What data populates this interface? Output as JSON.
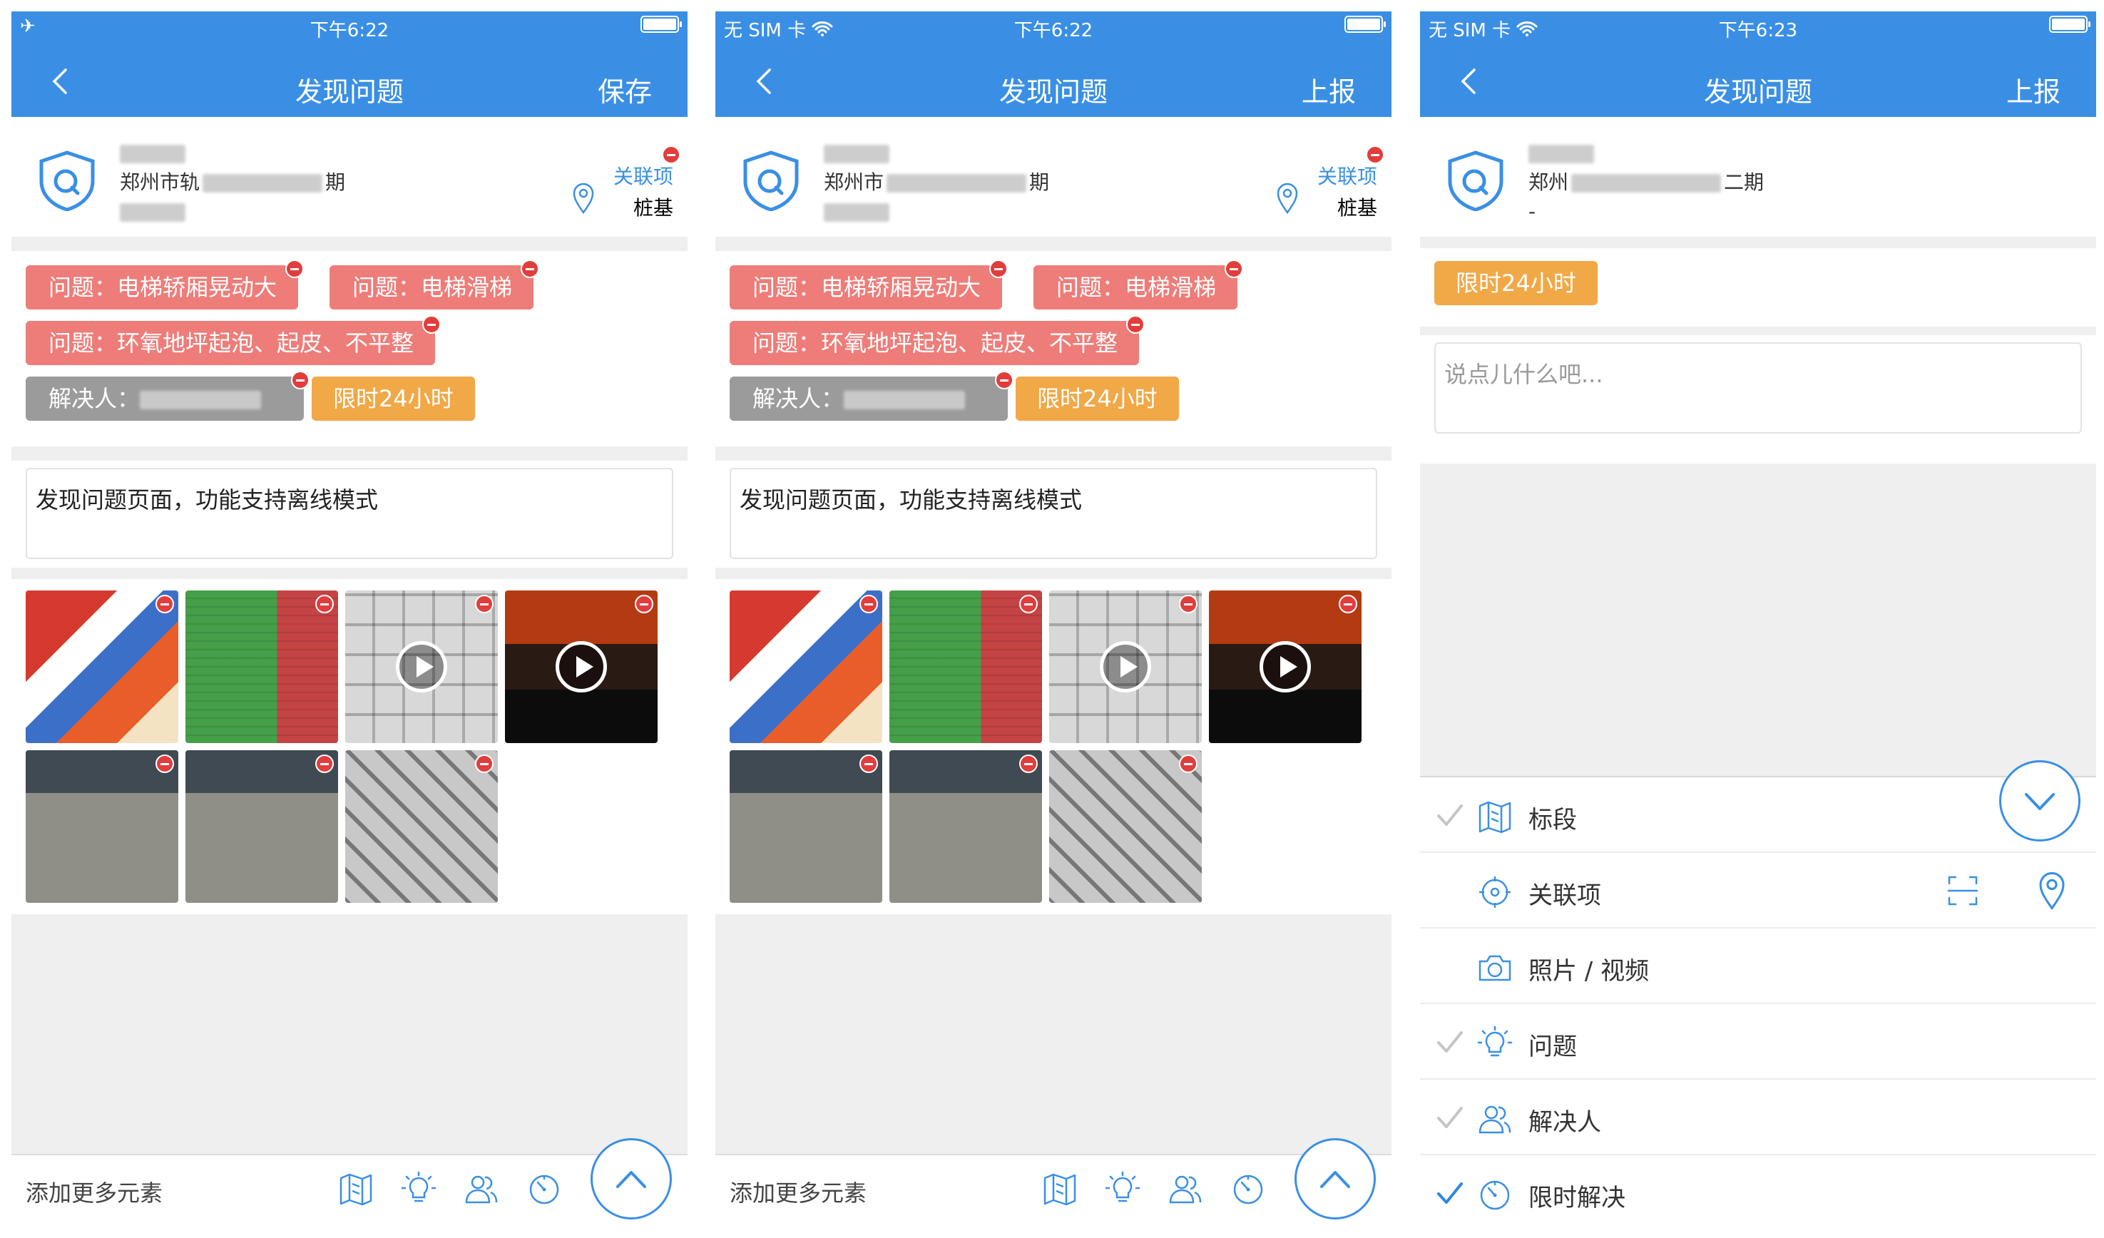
{
  "colors": {
    "primary": "#3a8fe5",
    "tag_red": "#ee7d79",
    "tag_grey": "#9b9b9b",
    "tag_orange": "#f1a846",
    "remove": "#e23d3d"
  },
  "screens": [
    {
      "status": {
        "carrier": "✈",
        "time": "下午6:22"
      },
      "nav": {
        "title": "发现问题",
        "action": "保存"
      },
      "info": {
        "line1_prefix": "",
        "line2": "郑州市轨",
        "line2_suffix": "期",
        "link_label": "关联项",
        "link_sub": "桩基"
      },
      "tags": {
        "problem1": "问题：电梯轿厢晃动大",
        "problem2": "问题：电梯滑梯",
        "problem3": "问题：环氧地坪起泡、起皮、不平整",
        "resolver": "解决人：",
        "limit": "限时24小时"
      },
      "note": "发现问题页面，功能支持离线模式",
      "bottom": {
        "label": "添加更多元素"
      }
    },
    {
      "status": {
        "carrier": "无 SIM 卡",
        "time": "下午6:22"
      },
      "nav": {
        "title": "发现问题",
        "action": "上报"
      },
      "info": {
        "line1_prefix": "",
        "line2": "郑州市",
        "line2_suffix": "期",
        "link_label": "关联项",
        "link_sub": "桩基"
      },
      "tags": {
        "problem1": "问题：电梯轿厢晃动大",
        "problem2": "问题：电梯滑梯",
        "problem3": "问题：环氧地坪起泡、起皮、不平整",
        "resolver": "解决人：",
        "limit": "限时24小时"
      },
      "note": "发现问题页面，功能支持离线模式",
      "bottom": {
        "label": "添加更多元素"
      }
    },
    {
      "status": {
        "carrier": "无 SIM 卡",
        "time": "下午6:23"
      },
      "nav": {
        "title": "发现问题",
        "action": "上报"
      },
      "info": {
        "line1_prefix": "",
        "line2": "郑州",
        "line2_suffix": "二期",
        "line3": "-"
      },
      "tags": {
        "limit": "限时24小时"
      },
      "note_placeholder": "说点儿什么吧...",
      "elements": [
        {
          "label": "标段",
          "icon": "map-icon",
          "checked": "grey"
        },
        {
          "label": "关联项",
          "icon": "crosshair-icon",
          "checked": "none"
        },
        {
          "label": "照片 / 视频",
          "icon": "camera-icon",
          "checked": "none"
        },
        {
          "label": "问题",
          "icon": "bulb-icon",
          "checked": "grey"
        },
        {
          "label": "解决人",
          "icon": "people-icon",
          "checked": "grey"
        },
        {
          "label": "限时解决",
          "icon": "timer-icon",
          "checked": "blue"
        }
      ]
    }
  ]
}
